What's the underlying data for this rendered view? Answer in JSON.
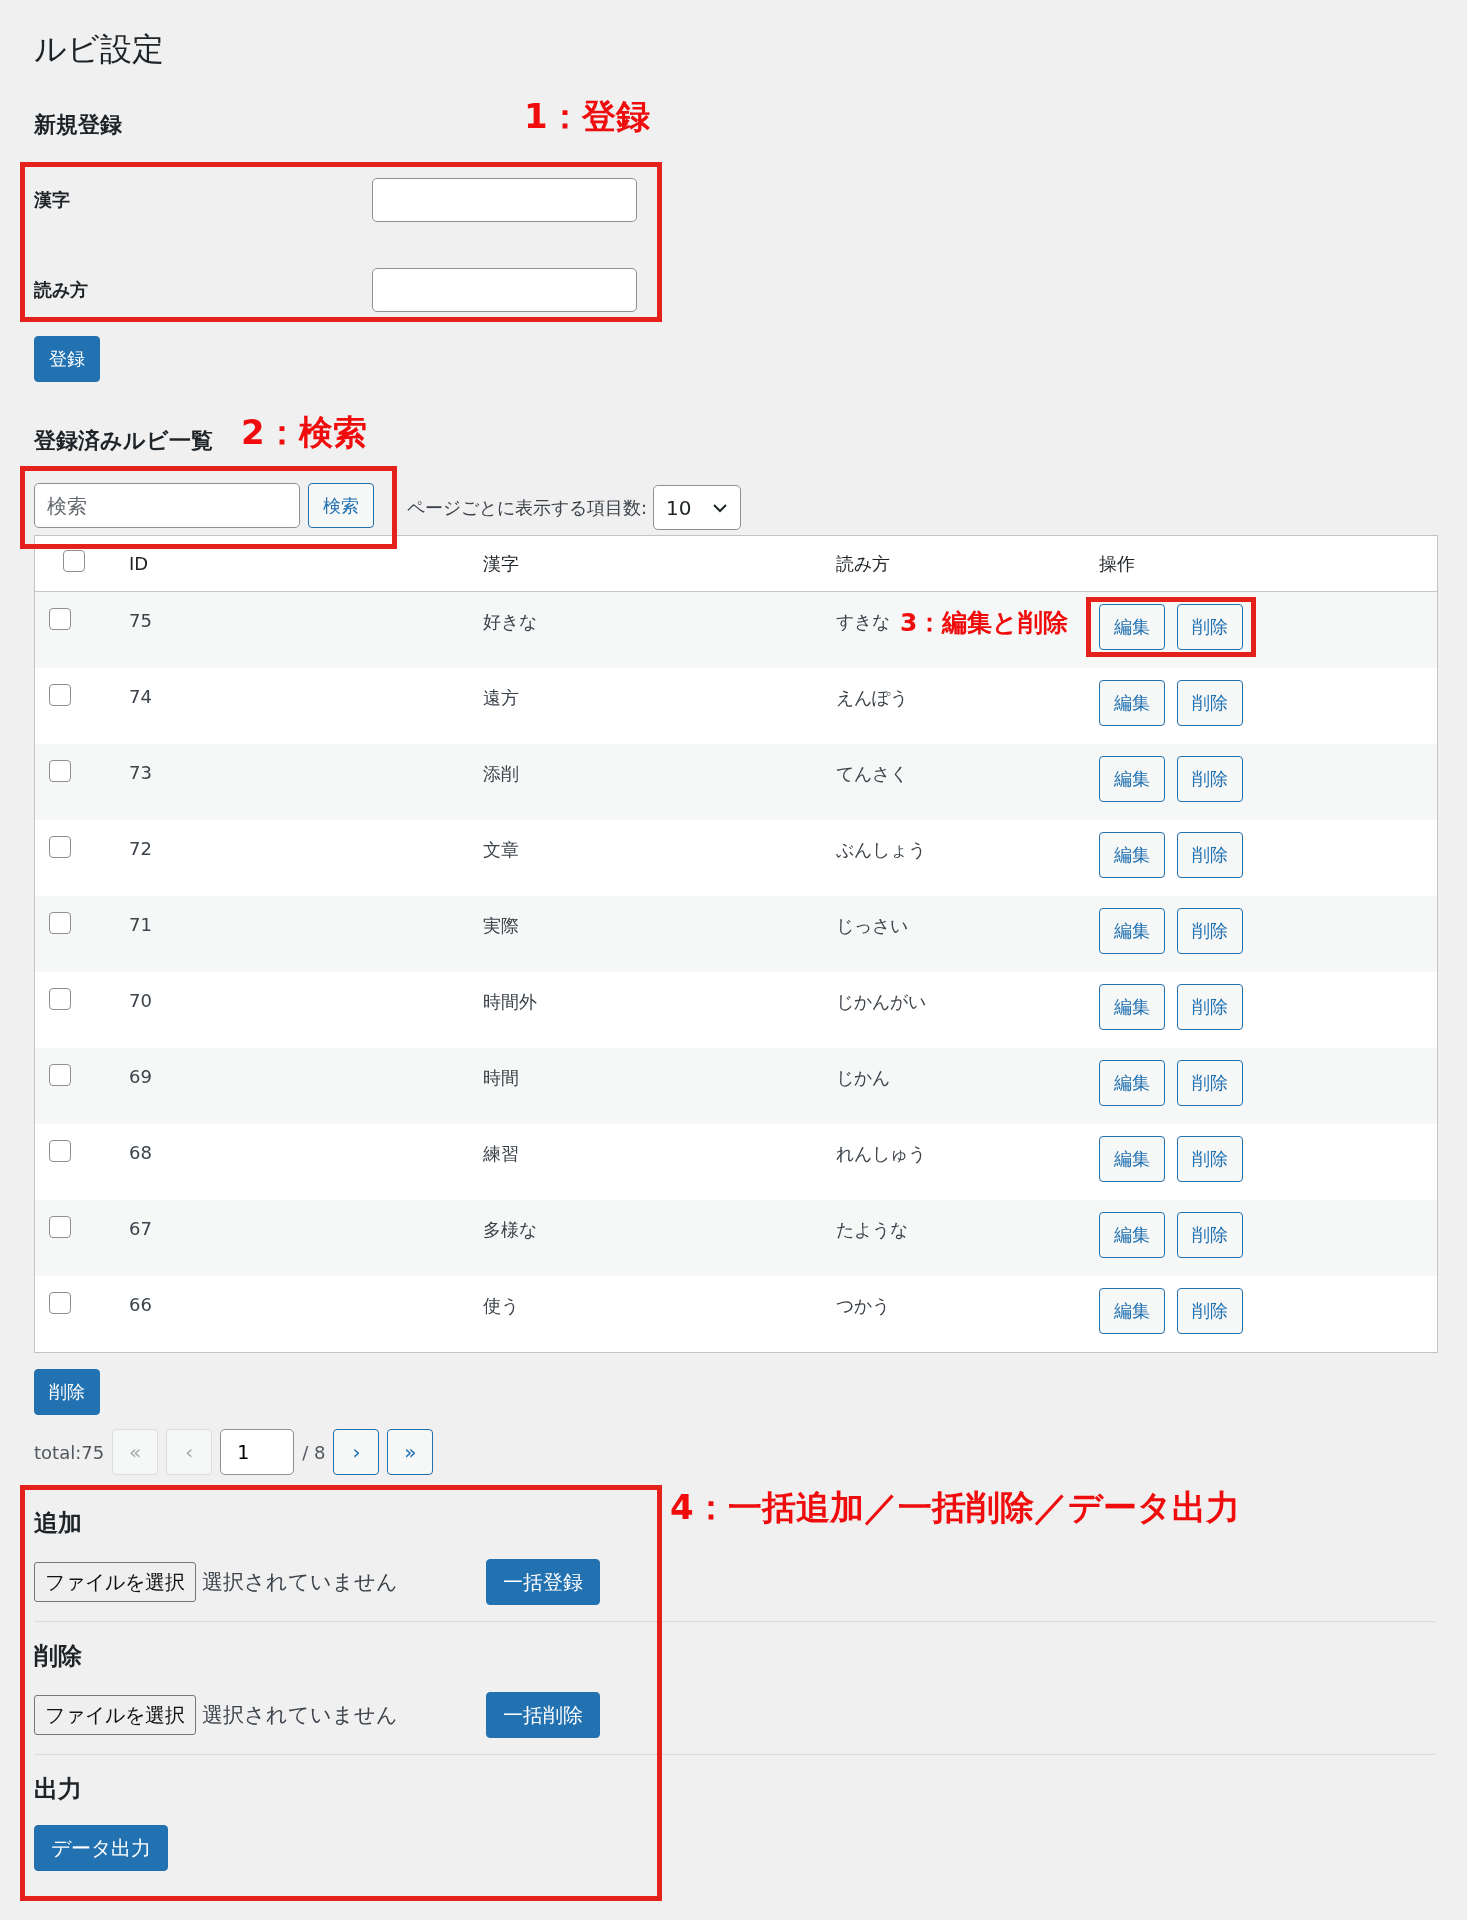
{
  "page_title": "ルビ設定",
  "new_entry": {
    "heading": "新規登録",
    "annotation": "1：登録",
    "fields": [
      {
        "label": "漢字"
      },
      {
        "label": "読み方"
      }
    ],
    "submit": "登録"
  },
  "list": {
    "heading": "登録済みルビ一覧",
    "annotation": "2：検索",
    "search": {
      "placeholder": "検索",
      "button": "検索"
    },
    "per_page": {
      "label": "ページごとに表示する項目数:",
      "value": "10"
    },
    "table": {
      "select_all_checked": false,
      "columns": [
        "ID",
        "漢字",
        "読み方",
        "操作"
      ],
      "rows": [
        {
          "checked": false,
          "id": "75",
          "kanji": "好きな",
          "reading": "すきな",
          "actions": [
            "編集",
            "削除"
          ],
          "annotation": "3：編集と削除"
        },
        {
          "checked": false,
          "id": "74",
          "kanji": "遠方",
          "reading": "えんぽう",
          "actions": [
            "編集",
            "削除"
          ]
        },
        {
          "checked": false,
          "id": "73",
          "kanji": "添削",
          "reading": "てんさく",
          "actions": [
            "編集",
            "削除"
          ]
        },
        {
          "checked": false,
          "id": "72",
          "kanji": "文章",
          "reading": "ぶんしょう",
          "actions": [
            "編集",
            "削除"
          ]
        },
        {
          "checked": false,
          "id": "71",
          "kanji": "実際",
          "reading": "じっさい",
          "actions": [
            "編集",
            "削除"
          ]
        },
        {
          "checked": false,
          "id": "70",
          "kanji": "時間外",
          "reading": "じかんがい",
          "actions": [
            "編集",
            "削除"
          ]
        },
        {
          "checked": false,
          "id": "69",
          "kanji": "時間",
          "reading": "じかん",
          "actions": [
            "編集",
            "削除"
          ]
        },
        {
          "checked": false,
          "id": "68",
          "kanji": "練習",
          "reading": "れんしゅう",
          "actions": [
            "編集",
            "削除"
          ]
        },
        {
          "checked": false,
          "id": "67",
          "kanji": "多様な",
          "reading": "たような",
          "actions": [
            "編集",
            "削除"
          ]
        },
        {
          "checked": false,
          "id": "66",
          "kanji": "使う",
          "reading": "つかう",
          "actions": [
            "編集",
            "削除"
          ]
        }
      ]
    },
    "bulk_delete": "削除",
    "pagination": {
      "total": "total:75",
      "buttons_before": [
        {
          "label": "«",
          "disabled": true
        },
        {
          "label": "‹",
          "disabled": true
        }
      ],
      "page": "1",
      "of": "/ 8",
      "buttons_after": [
        {
          "label": "›",
          "disabled": false
        },
        {
          "label": "»",
          "disabled": false
        }
      ]
    }
  },
  "bulk": {
    "annotation": "4：一括追加／一括削除／データ出力",
    "sections": [
      {
        "kind": "file",
        "heading": "追加",
        "file_button": "ファイルを選択",
        "file_status": "選択されていません",
        "action": "一括登録"
      },
      {
        "kind": "file",
        "heading": "削除",
        "file_button": "ファイルを選択",
        "file_status": "選択されていません",
        "action": "一括削除"
      },
      {
        "kind": "export",
        "heading": "出力",
        "action": "データ出力"
      }
    ]
  }
}
